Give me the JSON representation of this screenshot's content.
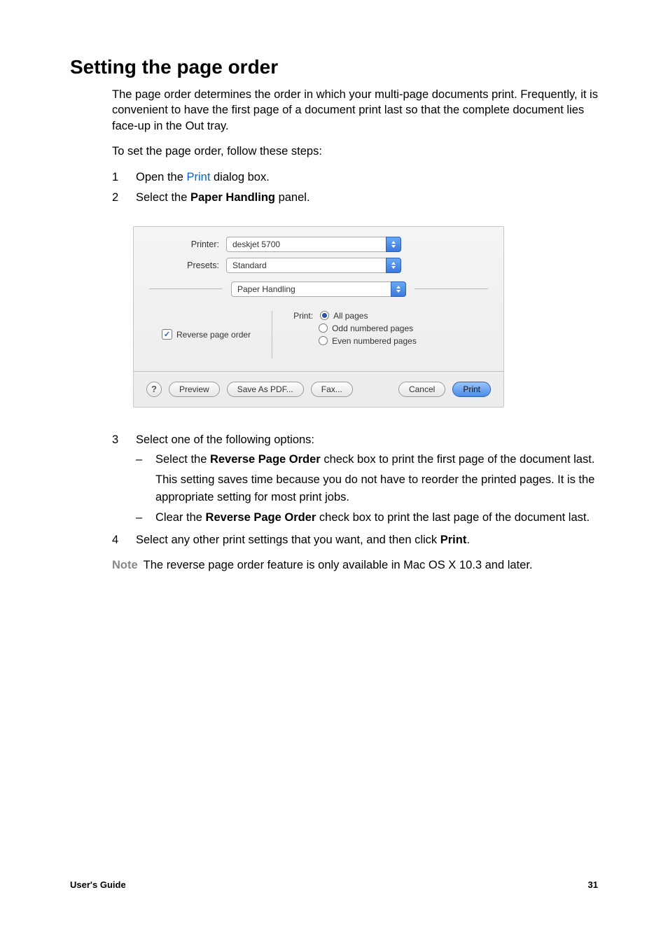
{
  "title": "Setting the page order",
  "intro": "The page order determines the order in which your multi-page documents print. Frequently, it is convenient to have the first page of a document print last so that the complete document lies face-up in the Out tray.",
  "lead_in": "To set the page order, follow these steps:",
  "steps": {
    "s1": {
      "num": "1",
      "pre": "Open the ",
      "link": "Print",
      "post": " dialog box."
    },
    "s2": {
      "num": "2",
      "pre": "Select the ",
      "bold": "Paper Handling",
      "post": " panel."
    },
    "s3": {
      "num": "3",
      "text": "Select one of the following options:",
      "bullets": [
        {
          "pre": "Select the ",
          "bold": "Reverse Page Order",
          "post": " check box to print the first page of the document last.",
          "extra": "This setting saves time because you do not have to reorder the printed pages. It is the appropriate setting for most print jobs."
        },
        {
          "pre": "Clear the ",
          "bold": "Reverse Page Order",
          "post": " check box to print the last page of the document last."
        }
      ]
    },
    "s4": {
      "num": "4",
      "pre": "Select any other print settings that you want, and then click ",
      "bold": "Print",
      "post": "."
    }
  },
  "note_label": "Note",
  "note_text": "The reverse page order feature is only available in Mac OS X 10.3 and later.",
  "dialog": {
    "printer_label": "Printer:",
    "printer_value": "deskjet 5700",
    "presets_label": "Presets:",
    "presets_value": "Standard",
    "panel_value": "Paper Handling",
    "reverse_label": "Reverse page order",
    "print_label": "Print:",
    "radio_all": "All pages",
    "radio_odd": "Odd numbered pages",
    "radio_even": "Even numbered pages",
    "help": "?",
    "preview": "Preview",
    "save_pdf": "Save As PDF...",
    "fax": "Fax...",
    "cancel": "Cancel",
    "print_btn": "Print"
  },
  "footer_left": "User's Guide",
  "footer_right": "31"
}
